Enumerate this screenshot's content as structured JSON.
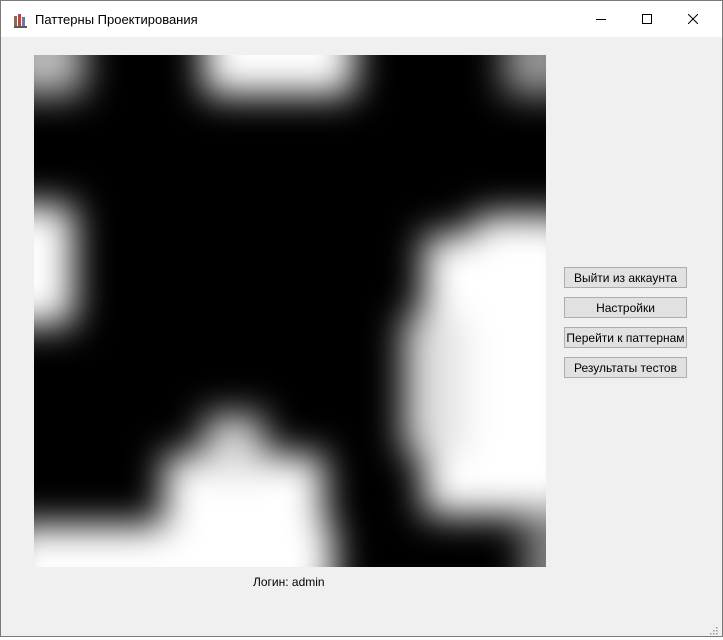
{
  "window": {
    "title": "Паттерны Проектирования"
  },
  "buttons": {
    "logout": "Выйти из аккаунта",
    "settings": "Настройки",
    "patterns": "Перейти к паттернам",
    "results": "Результаты тестов"
  },
  "status": {
    "login_label": "Логин: admin"
  },
  "icons": {
    "app": "app-icon",
    "minimize": "minimize-icon",
    "maximize": "maximize-icon",
    "close": "close-icon",
    "resize": "resize-grip-icon"
  }
}
